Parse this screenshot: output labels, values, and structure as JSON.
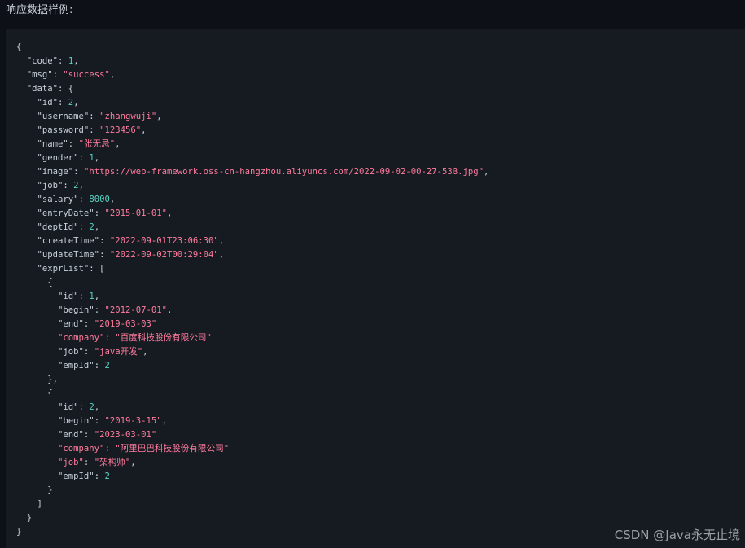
{
  "heading": "响应数据样例:",
  "watermark": "CSDN @Java永无止境",
  "colors": {
    "background": "#0d1117",
    "code_background": "#161b22",
    "text": "#c9d1d9",
    "string": "#ff7b9c",
    "number": "#56d4c3"
  },
  "code_lines": [
    [
      [
        "p",
        "{"
      ]
    ],
    [
      [
        "p",
        "  "
      ],
      [
        "k",
        "\"code\""
      ],
      [
        "p",
        ": "
      ],
      [
        "n",
        "1"
      ],
      [
        "p",
        ","
      ]
    ],
    [
      [
        "p",
        "  "
      ],
      [
        "k",
        "\"msg\""
      ],
      [
        "p",
        ": "
      ],
      [
        "s",
        "\"success\""
      ],
      [
        "p",
        ","
      ]
    ],
    [
      [
        "p",
        "  "
      ],
      [
        "k",
        "\"data\""
      ],
      [
        "p",
        ": {"
      ]
    ],
    [
      [
        "p",
        "    "
      ],
      [
        "k",
        "\"id\""
      ],
      [
        "p",
        ": "
      ],
      [
        "n",
        "2"
      ],
      [
        "p",
        ","
      ]
    ],
    [
      [
        "p",
        "    "
      ],
      [
        "k",
        "\"username\""
      ],
      [
        "p",
        ": "
      ],
      [
        "s",
        "\"zhangwuji\""
      ],
      [
        "p",
        ","
      ]
    ],
    [
      [
        "p",
        "    "
      ],
      [
        "k",
        "\"password\""
      ],
      [
        "p",
        ": "
      ],
      [
        "s",
        "\"123456\""
      ],
      [
        "p",
        ","
      ]
    ],
    [
      [
        "p",
        "    "
      ],
      [
        "k",
        "\"name\""
      ],
      [
        "p",
        ": "
      ],
      [
        "s",
        "\"张无忌\""
      ],
      [
        "p",
        ","
      ]
    ],
    [
      [
        "p",
        "    "
      ],
      [
        "k",
        "\"gender\""
      ],
      [
        "p",
        ": "
      ],
      [
        "n",
        "1"
      ],
      [
        "p",
        ","
      ]
    ],
    [
      [
        "p",
        "    "
      ],
      [
        "k",
        "\"image\""
      ],
      [
        "p",
        ": "
      ],
      [
        "s",
        "\"https://web-framework.oss-cn-hangzhou.aliyuncs.com/2022-09-02-00-27-53B.jpg\""
      ],
      [
        "p",
        ","
      ]
    ],
    [
      [
        "p",
        "    "
      ],
      [
        "k",
        "\"job\""
      ],
      [
        "p",
        ": "
      ],
      [
        "n",
        "2"
      ],
      [
        "p",
        ","
      ]
    ],
    [
      [
        "p",
        "    "
      ],
      [
        "k",
        "\"salary\""
      ],
      [
        "p",
        ": "
      ],
      [
        "n",
        "8000"
      ],
      [
        "p",
        ","
      ]
    ],
    [
      [
        "p",
        "    "
      ],
      [
        "k",
        "\"entryDate\""
      ],
      [
        "p",
        ": "
      ],
      [
        "s",
        "\"2015-01-01\""
      ],
      [
        "p",
        ","
      ]
    ],
    [
      [
        "p",
        "    "
      ],
      [
        "k",
        "\"deptId\""
      ],
      [
        "p",
        ": "
      ],
      [
        "n",
        "2"
      ],
      [
        "p",
        ","
      ]
    ],
    [
      [
        "p",
        "    "
      ],
      [
        "k",
        "\"createTime\""
      ],
      [
        "p",
        ": "
      ],
      [
        "s",
        "\"2022-09-01T23:06:30\""
      ],
      [
        "p",
        ","
      ]
    ],
    [
      [
        "p",
        "    "
      ],
      [
        "k",
        "\"updateTime\""
      ],
      [
        "p",
        ": "
      ],
      [
        "s",
        "\"2022-09-02T00:29:04\""
      ],
      [
        "p",
        ","
      ]
    ],
    [
      [
        "p",
        "    "
      ],
      [
        "k",
        "\"exprList\""
      ],
      [
        "p",
        ": ["
      ]
    ],
    [
      [
        "p",
        "      {"
      ]
    ],
    [
      [
        "p",
        "        "
      ],
      [
        "k",
        "\"id\""
      ],
      [
        "p",
        ": "
      ],
      [
        "n",
        "1"
      ],
      [
        "p",
        ","
      ]
    ],
    [
      [
        "p",
        "        "
      ],
      [
        "k",
        "\"begin\""
      ],
      [
        "p",
        ": "
      ],
      [
        "s",
        "\"2012-07-01\""
      ],
      [
        "p",
        ","
      ]
    ],
    [
      [
        "p",
        "        "
      ],
      [
        "k",
        "\"end\""
      ],
      [
        "p",
        ": "
      ],
      [
        "s",
        "\"2019-03-03\""
      ]
    ],
    [
      [
        "p",
        "        "
      ],
      [
        "s",
        "\"company\""
      ],
      [
        "p",
        ": "
      ],
      [
        "s",
        "\"百度科技股份有限公司\""
      ]
    ],
    [
      [
        "p",
        "        "
      ],
      [
        "k",
        "\"job\""
      ],
      [
        "p",
        ": "
      ],
      [
        "s",
        "\"java开发\""
      ],
      [
        "p",
        ","
      ]
    ],
    [
      [
        "p",
        "        "
      ],
      [
        "k",
        "\"empId\""
      ],
      [
        "p",
        ": "
      ],
      [
        "n",
        "2"
      ]
    ],
    [
      [
        "p",
        "      },"
      ]
    ],
    [
      [
        "p",
        "      {"
      ]
    ],
    [
      [
        "p",
        "        "
      ],
      [
        "k",
        "\"id\""
      ],
      [
        "p",
        ": "
      ],
      [
        "n",
        "2"
      ],
      [
        "p",
        ","
      ]
    ],
    [
      [
        "p",
        "        "
      ],
      [
        "k",
        "\"begin\""
      ],
      [
        "p",
        ": "
      ],
      [
        "s",
        "\"2019-3-15\""
      ],
      [
        "p",
        ","
      ]
    ],
    [
      [
        "p",
        "        "
      ],
      [
        "k",
        "\"end\""
      ],
      [
        "p",
        ": "
      ],
      [
        "s",
        "\"2023-03-01\""
      ]
    ],
    [
      [
        "p",
        "        "
      ],
      [
        "s",
        "\"company\""
      ],
      [
        "p",
        ": "
      ],
      [
        "s",
        "\"阿里巴巴科技股份有限公司\""
      ]
    ],
    [
      [
        "p",
        "        "
      ],
      [
        "s",
        "\"job\""
      ],
      [
        "p",
        ": "
      ],
      [
        "s",
        "\"架构师\""
      ],
      [
        "p",
        ","
      ]
    ],
    [
      [
        "p",
        "        "
      ],
      [
        "k",
        "\"empId\""
      ],
      [
        "p",
        ": "
      ],
      [
        "n",
        "2"
      ]
    ],
    [
      [
        "p",
        "      }"
      ]
    ],
    [
      [
        "p",
        "    ]"
      ]
    ],
    [
      [
        "p",
        "  }"
      ]
    ],
    [
      [
        "p",
        "}"
      ]
    ]
  ]
}
